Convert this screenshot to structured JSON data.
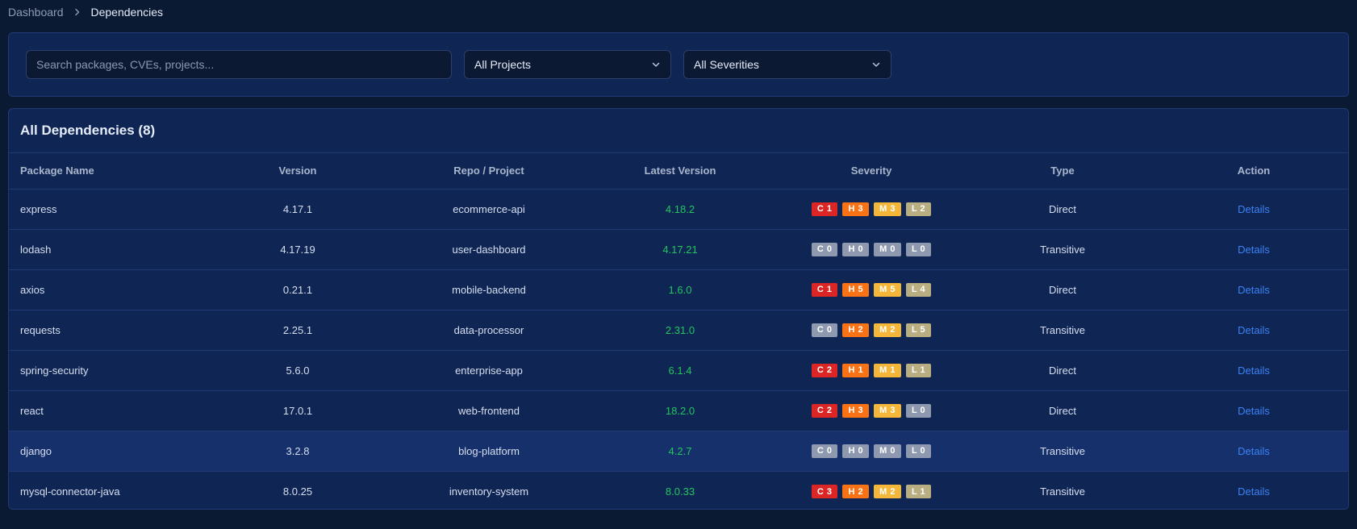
{
  "breadcrumb": {
    "parent": "Dashboard",
    "current": "Dependencies"
  },
  "filters": {
    "search_placeholder": "Search packages, CVEs, projects...",
    "project_selected": "All Projects",
    "severity_selected": "All Severities"
  },
  "table": {
    "title": "All Dependencies (8)",
    "columns": [
      "Package Name",
      "Version",
      "Repo / Project",
      "Latest Version",
      "Severity",
      "Type",
      "Action"
    ],
    "rows": [
      {
        "name": "express",
        "version": "4.17.1",
        "repo": "ecommerce-api",
        "latest": "4.18.2",
        "sev": [
          "C 1",
          "H 3",
          "M 3",
          "L 2"
        ],
        "type": "Direct",
        "action": "Details"
      },
      {
        "name": "lodash",
        "version": "4.17.19",
        "repo": "user-dashboard",
        "latest": "4.17.21",
        "sev": [
          "C 0",
          "H 0",
          "M 0",
          "L 0"
        ],
        "type": "Transitive",
        "action": "Details"
      },
      {
        "name": "axios",
        "version": "0.21.1",
        "repo": "mobile-backend",
        "latest": "1.6.0",
        "sev": [
          "C 1",
          "H 5",
          "M 5",
          "L 4"
        ],
        "type": "Direct",
        "action": "Details"
      },
      {
        "name": "requests",
        "version": "2.25.1",
        "repo": "data-processor",
        "latest": "2.31.0",
        "sev": [
          "C 0",
          "H 2",
          "M 2",
          "L 5"
        ],
        "type": "Transitive",
        "action": "Details"
      },
      {
        "name": "spring-security",
        "version": "5.6.0",
        "repo": "enterprise-app",
        "latest": "6.1.4",
        "sev": [
          "C 2",
          "H 1",
          "M 1",
          "L 1"
        ],
        "type": "Direct",
        "action": "Details"
      },
      {
        "name": "react",
        "version": "17.0.1",
        "repo": "web-frontend",
        "latest": "18.2.0",
        "sev": [
          "C 2",
          "H 3",
          "M 3",
          "L 0"
        ],
        "type": "Direct",
        "action": "Details"
      },
      {
        "name": "django",
        "version": "3.2.8",
        "repo": "blog-platform",
        "latest": "4.2.7",
        "sev": [
          "C 0",
          "H 0",
          "M 0",
          "L 0"
        ],
        "type": "Transitive",
        "action": "Details"
      },
      {
        "name": "mysql-connector-java",
        "version": "8.0.25",
        "repo": "inventory-system",
        "latest": "8.0.33",
        "sev": [
          "C 3",
          "H 2",
          "M 2",
          "L 1"
        ],
        "type": "Transitive",
        "action": "Details"
      }
    ]
  },
  "colors": {
    "critical": "#dc2626",
    "high": "#f97316",
    "medium": "#f4b73a",
    "low": "#b9ae82",
    "zero": "#8e99af",
    "latest_version": "#22c55e",
    "link": "#3b82f6"
  }
}
